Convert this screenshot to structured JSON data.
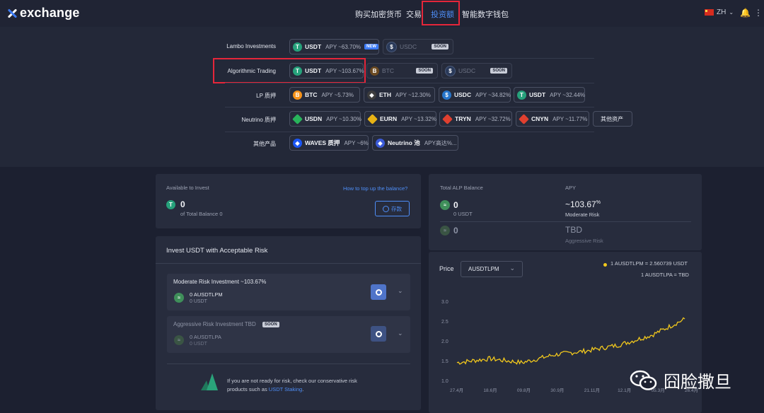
{
  "header": {
    "brand": "exchange",
    "nav": [
      "购买加密货币",
      "交易",
      "投资额",
      "智能数字钱包"
    ],
    "active_nav": "投资额",
    "lang": "ZH"
  },
  "products": {
    "rows": [
      {
        "label": "Lambo Investments",
        "pills": [
          {
            "coin": "USDT",
            "apy": "APY ~63.70%",
            "tag": "NEW",
            "color": "#26a17b"
          },
          {
            "coin": "USDC",
            "apy": "",
            "tag": "SOON",
            "color": "#2775ca",
            "dim": true
          }
        ]
      },
      {
        "label": "Algorithmic Trading",
        "pills": [
          {
            "coin": "USDT",
            "apy": "APY ~103.67%",
            "tag": "",
            "color": "#26a17b"
          },
          {
            "coin": "BTC",
            "apy": "",
            "tag": "SOON",
            "color": "#f7931a",
            "dim": true
          },
          {
            "coin": "USDC",
            "apy": "",
            "tag": "SOON",
            "color": "#2775ca",
            "dim": true
          }
        ]
      },
      {
        "label": "LP 质押",
        "pills": [
          {
            "coin": "BTC",
            "apy": "APY ~5.73%",
            "color": "#f7931a"
          },
          {
            "coin": "ETH",
            "apy": "APY ~12.30%",
            "color": "#3c3c3d"
          },
          {
            "coin": "USDC",
            "apy": "APY ~34.82%",
            "color": "#2775ca"
          },
          {
            "coin": "USDT",
            "apy": "APY ~32.44%",
            "color": "#26a17b"
          }
        ]
      },
      {
        "label": "Neutrino 质押",
        "pills": [
          {
            "coin": "USDN",
            "apy": "APY ~10.30%",
            "color": "#28b45b"
          },
          {
            "coin": "EURN",
            "apy": "APY ~13.32%",
            "color": "#e8b315"
          },
          {
            "coin": "TRYN",
            "apy": "APY ~32.72%",
            "color": "#e0402f"
          },
          {
            "coin": "CNYN",
            "apy": "APY ~11.77%",
            "color": "#e0402f"
          },
          {
            "coin": "其他资产",
            "apy": "",
            "color": ""
          }
        ]
      },
      {
        "label": "其他产品",
        "pills": [
          {
            "coin": "WAVES 质押",
            "apy": "APY ~6%",
            "color": "#1b56f5"
          },
          {
            "coin": "Neutrino 池",
            "apy": "APY高达%...",
            "color": "#3b5bd9"
          }
        ]
      }
    ]
  },
  "balance_card": {
    "title": "Available to Invest",
    "link": "How to top up the balance?",
    "amount": "0",
    "subtitle": "of Total Balance 0",
    "deposit": "存款"
  },
  "invest_card": {
    "title": "Invest USDT with Acceptable Risk",
    "moderate": {
      "title": "Moderate Risk Investment ~103.67%",
      "amount": "0 AUSDTLPM",
      "sub": "0 USDT"
    },
    "aggressive": {
      "title": "Aggressive Risk Investment TBD",
      "tag": "SOON",
      "amount": "0 AUSDTLPA",
      "sub": "0 USDT"
    },
    "note_line1": "If you are not ready for risk, check our conservative risk",
    "note_line2": "products such as",
    "note_link": "USDT Staking",
    "note_end": "."
  },
  "alp_card": {
    "title": "Total ALP Balance",
    "apy_title": "APY",
    "moderate_amount": "0",
    "moderate_sub": "0 USDT",
    "apy_value": "~103.67",
    "apy_unit": "%",
    "moderate_label": "Moderate Risk",
    "aggressive_amount": "0",
    "tbd": "TBD",
    "aggressive_label": "Aggressive Risk"
  },
  "price_card": {
    "label": "Price",
    "select_value": "AUSDTLPM",
    "legend1": "1 AUSDTLPM = 2.560739 USDT",
    "legend2": "1 AUSDTLPA = TBD"
  },
  "chart_data": {
    "type": "line",
    "title": "",
    "xlabel": "",
    "ylabel": "",
    "ylim": [
      1.0,
      3.0
    ],
    "yticks": [
      "3.0",
      "2.5",
      "2.0",
      "1.5",
      "1.0"
    ],
    "xticks": [
      "27.4月",
      "18.6月",
      "09.8月",
      "30.9月",
      "21.11月",
      "12.1月",
      "05.3月",
      "26.4月"
    ],
    "series": [
      {
        "color": "#f2c81c",
        "x": [
          "27.4月",
          "18.6月",
          "09.8月",
          "30.9月",
          "21.11月",
          "12.1月",
          "05.3月",
          "26.4月"
        ],
        "values": [
          1.45,
          1.55,
          1.45,
          1.65,
          1.75,
          1.9,
          2.15,
          2.55
        ]
      }
    ]
  },
  "watermark": "囧脸撒旦",
  "colors": {
    "accent": "#4e8ef7",
    "highlight": "#e5263a",
    "line": "#f2c81c"
  }
}
